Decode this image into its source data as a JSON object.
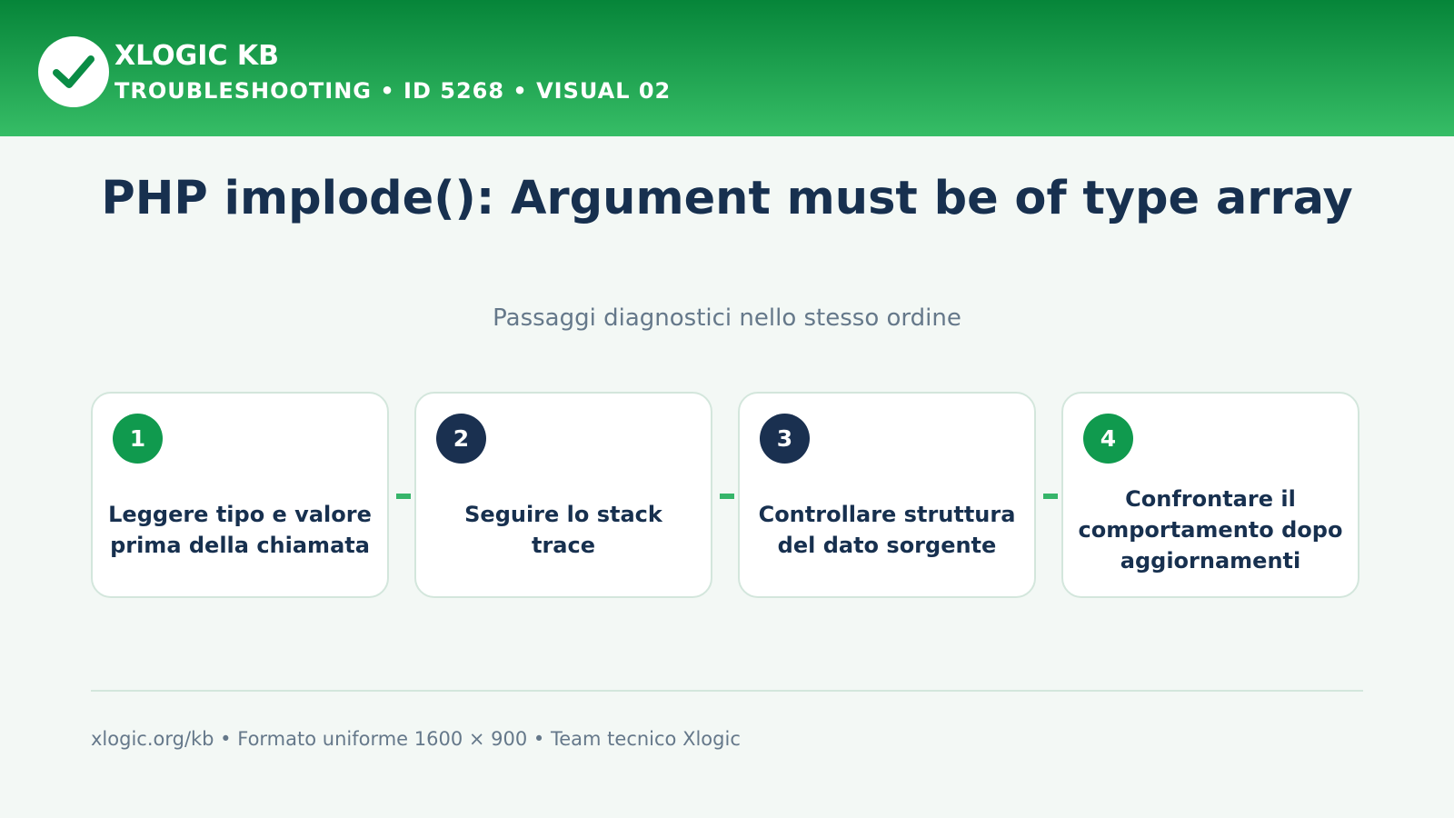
{
  "header": {
    "brand": "XLOGIC KB",
    "subtitle": "TROUBLESHOOTING • ID 5268 • VISUAL 02",
    "logo_icon": "check-icon"
  },
  "title": "PHP implode(): Argument must be of type array",
  "subtitle": "Passaggi diagnostici nello stesso ordine",
  "steps": [
    {
      "number": "1",
      "text": "Leggere tipo e valore prima della chiamata",
      "badge_color": "#109a4e"
    },
    {
      "number": "2",
      "text": "Seguire lo stack trace",
      "badge_color": "#1a3050"
    },
    {
      "number": "3",
      "text": "Controllare struttura del dato sorgente",
      "badge_color": "#1a3050"
    },
    {
      "number": "4",
      "text": "Confrontare il comportamento dopo aggiornamenti",
      "badge_color": "#109a4e"
    }
  ],
  "footer": "xlogic.org/kb • Formato uniforme 1600 × 900 • Team tecnico Xlogic",
  "colors": {
    "header_top": "#068539",
    "header_bottom": "#36bd66",
    "text_dark": "#17304f",
    "text_muted": "#65788a",
    "connector": "#36b56a"
  }
}
